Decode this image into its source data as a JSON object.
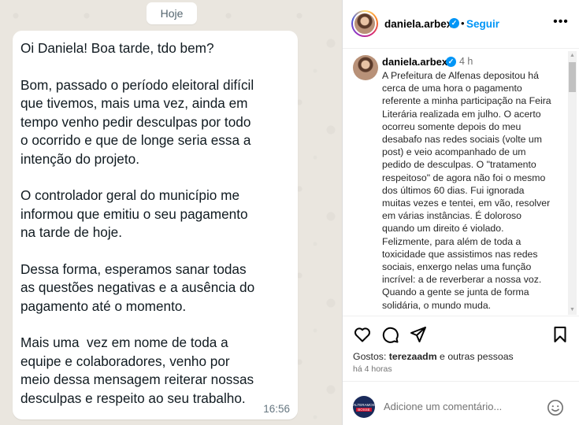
{
  "chat": {
    "date_label": "Hoje",
    "message": {
      "paragraphs": [
        [
          "Oi Daniela! Boa tarde, tdo bem?"
        ],
        [
          "Bom, passado o período eleitoral difícil",
          "que tivemos, mais uma vez, ainda em",
          "tempo venho pedir desculpas por todo",
          "o ocorrido e que de longe seria essa a",
          "intenção do projeto."
        ],
        [
          "O controlador geral do município me",
          "informou que emitiu o seu pagamento",
          "na tarde de hoje."
        ],
        [
          "Dessa forma, esperamos sanar todas",
          "as questões negativas e a ausência do",
          "pagamento até o momento."
        ],
        [
          "Mais uma  vez em nome de toda a",
          "equipe e colaboradores, venho por",
          "meio dessa mensagem reiterar nossas",
          "desculpas e respeito ao seu trabalho."
        ]
      ],
      "time": "16:56"
    }
  },
  "post": {
    "header": {
      "username": "daniela.arbex",
      "separator": "•",
      "follow_label": "Seguir",
      "more_icon": "more-horizontal-icon"
    },
    "caption": {
      "username": "daniela.arbex",
      "time": "4 h",
      "lines": [
        "A Prefeitura de Alfenas depositou há",
        "cerca de uma hora o pagamento",
        "referente a minha participação na Feira",
        "Literária realizada em julho. O acerto",
        "ocorreu somente depois do meu",
        "desabafo nas redes sociais (volte um",
        "post) e veio acompanhado de um",
        "pedido de desculpas. O \"tratamento",
        "respeitoso\" de agora não foi o mesmo",
        "dos últimos 60 dias. Fui ignorada",
        "muitas vezes e tentei, em vão, resolver",
        "em várias instâncias. É doloroso",
        "quando um direito é violado.",
        "Felizmente, para além de toda a",
        "toxicidade que assistimos nas redes",
        "sociais, enxergo nelas uma função",
        "incrível: a de reverberar a nossa voz.",
        "Quando a gente se junta de forma",
        "solidária, o mundo muda."
      ]
    },
    "actions": {
      "icons": [
        "heart-icon",
        "comment-icon",
        "share-icon",
        "bookmark-icon"
      ]
    },
    "likes": {
      "prefix": "Gostos: ",
      "user": "terezaadm",
      "suffix": " e outras pessoas"
    },
    "age": "há 4 horas",
    "comment": {
      "placeholder": "Adicione um comentário...",
      "avatar_text_top": "ALTERAMOS",
      "avatar_text_bottom": "BOSSE"
    },
    "colors": {
      "accent": "#0095f6",
      "text": "#262626",
      "secondary": "#737373"
    }
  }
}
